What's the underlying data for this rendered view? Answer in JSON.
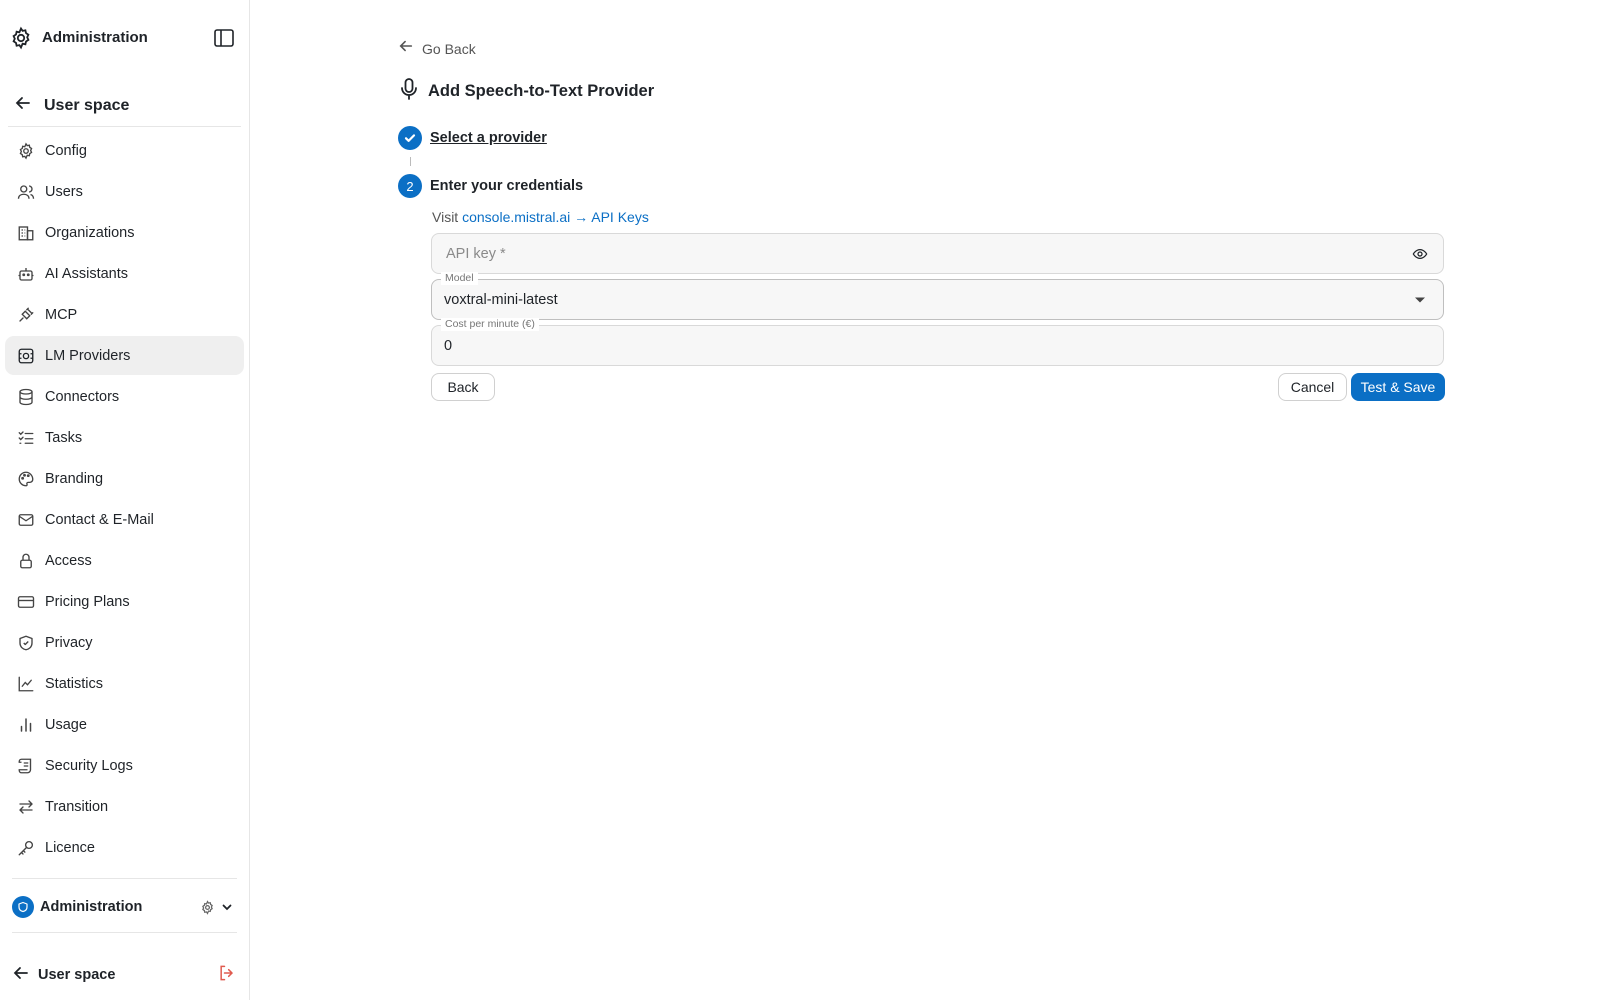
{
  "sidebar": {
    "header_title": "Administration",
    "back_label": "User space",
    "items": [
      {
        "label": "Config",
        "icon": "settings-icon"
      },
      {
        "label": "Users",
        "icon": "users-icon"
      },
      {
        "label": "Organizations",
        "icon": "building-icon"
      },
      {
        "label": "AI Assistants",
        "icon": "bot-icon"
      },
      {
        "label": "MCP",
        "icon": "plug-icon"
      },
      {
        "label": "LM Providers",
        "icon": "provider-icon"
      },
      {
        "label": "Connectors",
        "icon": "database-icon"
      },
      {
        "label": "Tasks",
        "icon": "list-check-icon"
      },
      {
        "label": "Branding",
        "icon": "palette-icon"
      },
      {
        "label": "Contact & E-Mail",
        "icon": "mail-icon"
      },
      {
        "label": "Access",
        "icon": "lock-icon"
      },
      {
        "label": "Pricing Plans",
        "icon": "credit-card-icon"
      },
      {
        "label": "Privacy",
        "icon": "shield-check-icon"
      },
      {
        "label": "Statistics",
        "icon": "chart-line-icon"
      },
      {
        "label": "Usage",
        "icon": "bar-chart-icon"
      },
      {
        "label": "Security Logs",
        "icon": "scroll-icon"
      },
      {
        "label": "Transition",
        "icon": "arrows-left-right-icon"
      },
      {
        "label": "Licence",
        "icon": "key-icon"
      }
    ],
    "active_item": "LM Providers",
    "org_label": "Administration",
    "footer_label": "User space"
  },
  "main": {
    "go_back": "Go Back",
    "title": "Add Speech-to-Text Provider",
    "step1_label": "Select a provider",
    "step2_number": "2",
    "step2_label": "Enter your credentials",
    "visit_prefix": "Visit",
    "visit_link": "console.mistral.ai → API Keys",
    "api_key": {
      "placeholder": "API key *",
      "value": ""
    },
    "model": {
      "label": "Model",
      "value": "voxtral-mini-latest"
    },
    "cost": {
      "label": "Cost per minute (€)",
      "value": "0"
    },
    "buttons": {
      "back": "Back",
      "cancel": "Cancel",
      "save": "Test & Save"
    }
  },
  "colors": {
    "accent": "#0b6fc5",
    "logout": "#e05a4e",
    "active_bg": "#efefef"
  }
}
